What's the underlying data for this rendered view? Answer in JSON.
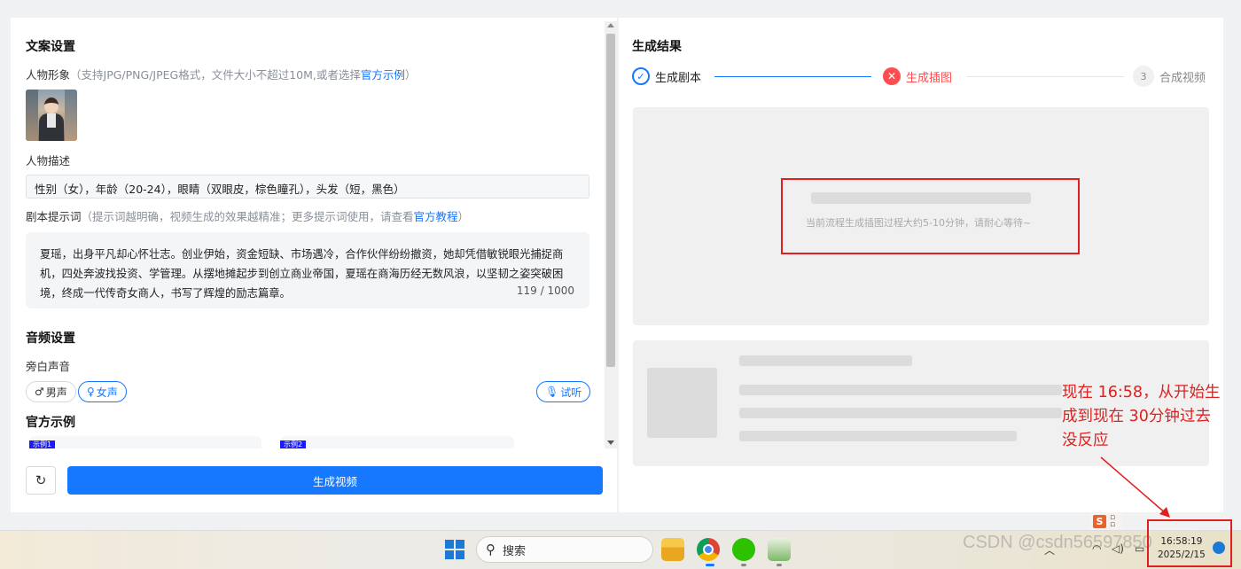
{
  "left": {
    "copy_settings_title": "文案设置",
    "character_label": "人物形象",
    "character_hint": "（支持JPG/PNG/JPEG格式，文件大小不超过10M,或者选择",
    "character_hint_link": "官方示例",
    "character_hint_end": "）",
    "desc_label": "人物描述",
    "desc_value": "性别（女），年龄（20-24），眼睛（双眼皮，棕色瞳孔），头发（短，黑色）",
    "prompt_label": "剧本提示词",
    "prompt_hint": "（提示词越明确，视频生成的效果越精准；更多提示词使用，请查看",
    "prompt_hint_link": "官方教程",
    "prompt_hint_end": "）",
    "prompt_text": "夏瑶，出身平凡却心怀壮志。创业伊始，资金短缺、市场遇冷，合作伙伴纷纷撤资，她却凭借敏锐眼光捕捉商机，四处奔波找投资、学管理。从摆地摊起步到创立商业帝国，夏瑶在商海历经无数风浪，以坚韧之姿突破困境，终成一代传奇女商人，书写了辉煌的励志篇章。",
    "prompt_counter": "119 / 1000",
    "audio_title": "音频设置",
    "narrator_label": "旁白声音",
    "male_voice": "男声",
    "female_voice": "女声",
    "listen": "试听",
    "examples_title": "官方示例",
    "example1_tag": "示例1",
    "example2_tag": "示例2",
    "generate_button": "生成视频"
  },
  "right": {
    "result_title": "生成结果",
    "steps": [
      {
        "label": "生成剧本",
        "status": "done"
      },
      {
        "label": "生成插图",
        "status": "error"
      },
      {
        "label": "合成视频",
        "status": "pending",
        "number": "3"
      }
    ],
    "loading_text": "当前流程生成插图过程大约5-10分钟，请耐心等待~"
  },
  "annotation": {
    "lines": [
      "现在 16:58，从开始生",
      "成到现在 30分钟过去",
      "没反应"
    ],
    "color": "#e02020"
  },
  "taskbar": {
    "search_placeholder": "搜索",
    "time": "16:58:19",
    "date": "2025/2/15"
  },
  "watermark": "CSDN @csdn56597850",
  "colors": {
    "accent": "#1677ff",
    "error": "#ff4d4f"
  }
}
